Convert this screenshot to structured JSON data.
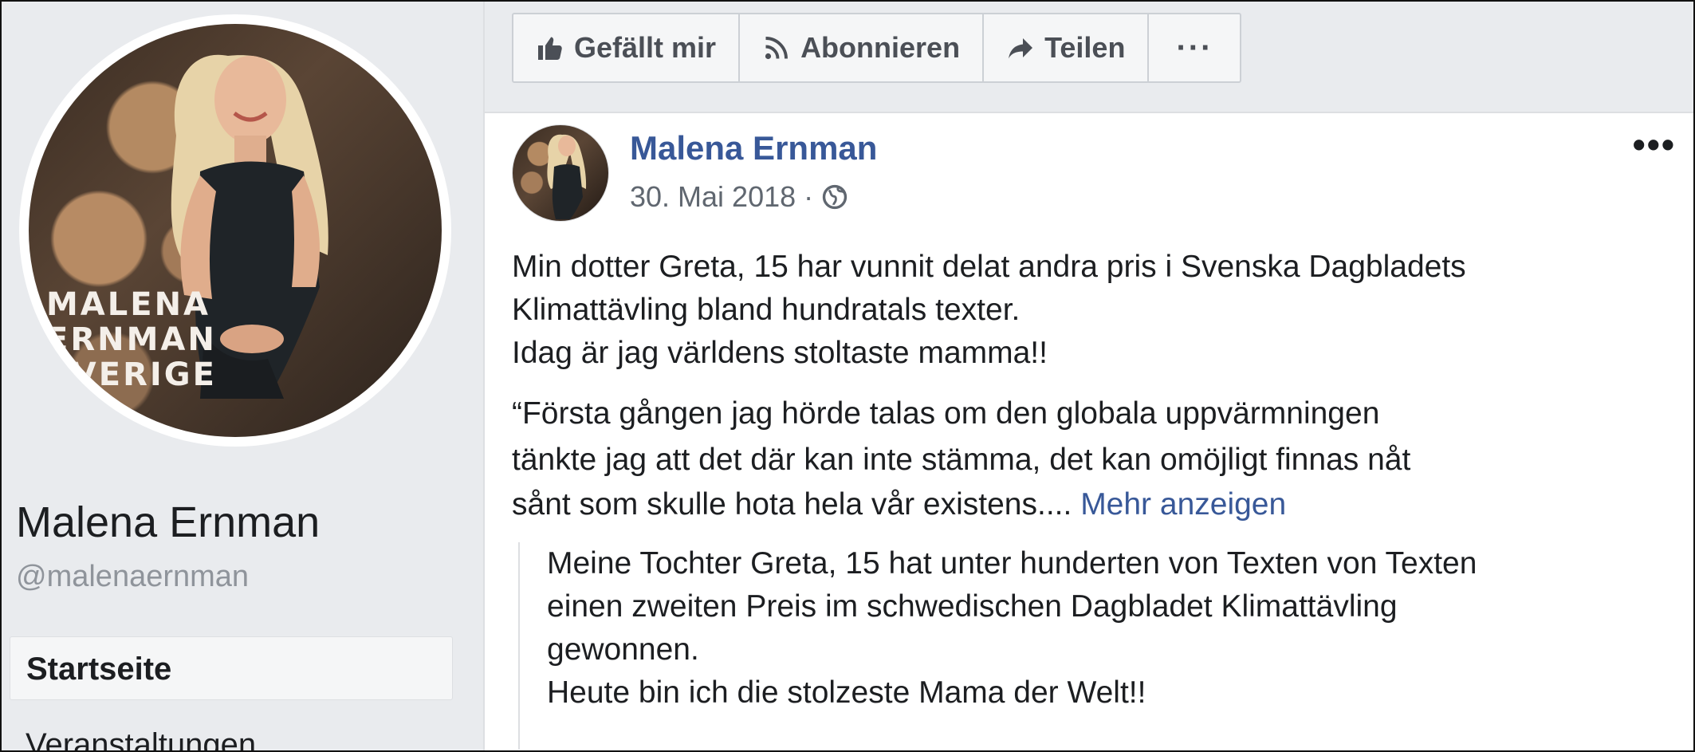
{
  "sidebar": {
    "avatar_text_lines": [
      "MALENA",
      "ERNMAN",
      "SVERIGE"
    ],
    "page_name": "Malena Ernman",
    "handle": "@malenaernman",
    "nav_active": "Startseite",
    "nav_next": "Veranstaltungen"
  },
  "actions": {
    "like": "Gefällt mir",
    "subscribe": "Abonnieren",
    "share": "Teilen",
    "more": "···"
  },
  "post": {
    "author": "Malena Ernman",
    "date": "30. Mai 2018",
    "separator": "·",
    "menu": "•••",
    "lines": [
      "Min dotter Greta, 15 har vunnit delat andra pris i Svenska Dagbladets",
      "Klimattävling bland hundratals texter.",
      "Idag är jag världens stoltaste mamma!!"
    ],
    "quote_lines": [
      "“Första gången jag hörde talas om den globala uppvärmningen",
      "tänkte jag att det där kan inte stämma, det kan omöjligt finnas nåt"
    ],
    "quote_last": "sånt som skulle hota hela vår existens....",
    "see_more": "Mehr anzeigen",
    "translation_lines": [
      "Meine Tochter Greta, 15 hat unter hunderten von Texten von Texten",
      "einen zweiten Preis im schwedischen Dagbladet Klimattävling",
      "gewonnen.",
      "Heute bin ich die stolzeste Mama der Welt!!"
    ]
  },
  "colors": {
    "link": "#385898",
    "background": "#e9ebee",
    "text": "#1c1e21"
  },
  "icons": {
    "like": "thumbs-up-icon",
    "subscribe": "rss-icon",
    "share": "share-arrow-icon",
    "audience": "globe-icon"
  }
}
